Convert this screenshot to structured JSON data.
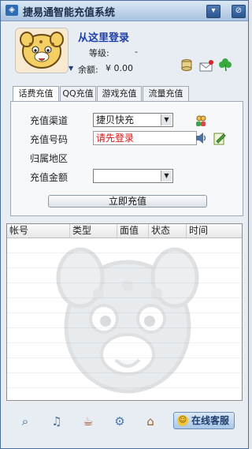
{
  "app": {
    "title": "捷易通智能充值系统"
  },
  "window_controls": {
    "minimize": "▾",
    "close": "⊘"
  },
  "user": {
    "login_link": "从这里登录",
    "level_label": "等级:",
    "level_value": "-",
    "balance_label": "余额:",
    "balance_value": "¥ 0.00"
  },
  "tabs": [
    "话费充值",
    "QQ充值",
    "游戏充值",
    "流量充值"
  ],
  "recharge_form": {
    "channel_label": "充值渠道",
    "channel_value": "捷贝快充",
    "number_label": "充值号码",
    "number_value": "请先登录",
    "region_label": "归属地区",
    "amount_label": "充值金额",
    "amount_value": "",
    "submit": "立即充值"
  },
  "records": {
    "columns": [
      "帐号",
      "类型",
      "面值",
      "状态",
      "时间"
    ],
    "rows": []
  },
  "bottom_bar": {
    "service_button": "在线客服"
  },
  "colors": {
    "accent": "#1e3fa8",
    "window_border": "#4b6f99",
    "error_text": "#d11111"
  }
}
